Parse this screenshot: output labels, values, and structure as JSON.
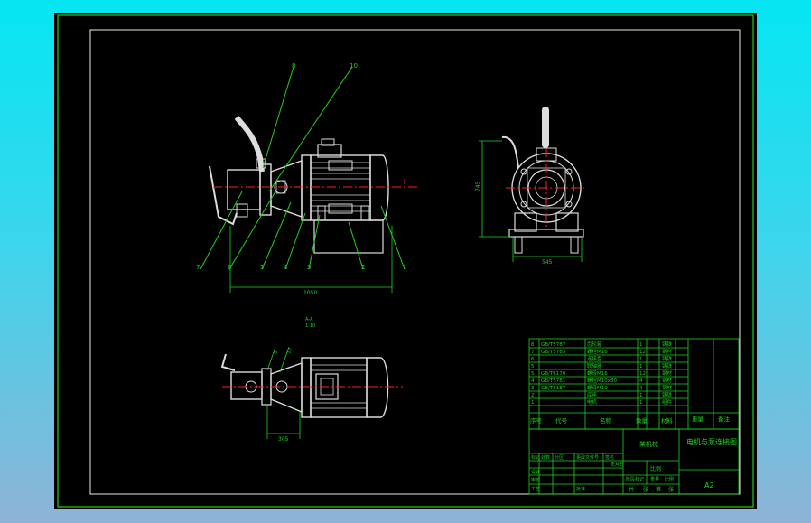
{
  "callouts_front": [
    "8",
    "10",
    "7",
    "6",
    "5",
    "4",
    "3",
    "2",
    "1"
  ],
  "callouts_top": [
    "8",
    "10"
  ],
  "dimensions": {
    "front_overall_length": "1050",
    "side_height": "745",
    "side_width": "545",
    "top_width": "305"
  },
  "section_label": {
    "line1": "A-A",
    "line2": "1:10"
  },
  "section_marks": [
    "A",
    "A"
  ],
  "bom": [
    {
      "no": "8",
      "code": "GB/T5787",
      "name": "齿轮箱",
      "qty": "1",
      "material": "铸铁"
    },
    {
      "no": "7",
      "code": "GB/T5783",
      "name": "螺栓M16",
      "qty": "12",
      "material": "钢材"
    },
    {
      "no": "6",
      "code": "",
      "name": "连接盘",
      "qty": "1",
      "material": "铸铁"
    },
    {
      "no": "5",
      "code": "",
      "name": "联轴器",
      "qty": "1",
      "material": "铸铁"
    },
    {
      "no": "5",
      "code": "GB/T6170",
      "name": "螺母M16",
      "qty": "12",
      "material": "钢材"
    },
    {
      "no": "4",
      "code": "GB/T5781",
      "name": "螺栓M10x80",
      "qty": "4",
      "material": "钢材"
    },
    {
      "no": "3",
      "code": "GB/T6187",
      "name": "螺母M10",
      "qty": "4",
      "material": "钢材"
    },
    {
      "no": "2",
      "code": "",
      "name": "底座",
      "qty": "1",
      "material": "铸铁"
    },
    {
      "no": "1",
      "code": "",
      "name": "电机",
      "qty": "1",
      "material": "组件"
    }
  ],
  "bom_header": {
    "no": "序号",
    "code": "代号",
    "name": "名称",
    "qty": "数量",
    "material": "材料",
    "weight": "重量",
    "remark": "备注"
  },
  "title_block": {
    "drawing_title": "电机与泵连接图",
    "company": "某机械",
    "scale_label": "比例",
    "sheet_size": "A2",
    "row_labels": [
      "标记",
      "处数",
      "分区",
      "更改文件号",
      "签名",
      "年月日"
    ],
    "role_labels": [
      "设计",
      "审核",
      "工艺",
      "批准"
    ],
    "stage_labels": [
      "阶段标记",
      "重量",
      "比例"
    ],
    "footer": [
      "共",
      "张",
      "第",
      "张"
    ]
  }
}
